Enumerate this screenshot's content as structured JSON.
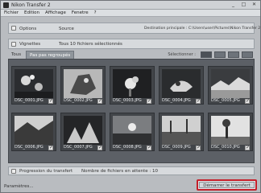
{
  "window": {
    "title": "Nikon Transfer 2"
  },
  "menu": {
    "items": [
      "Fichier",
      "Edition",
      "Affichage",
      "Fenetre",
      "?"
    ]
  },
  "source_row": {
    "label": "Options",
    "value": "Source",
    "destination": "Destination principale : C:\\Users\\user\\Pictures\\Nikon Transfer 2"
  },
  "selection_row": {
    "label": "Vignettes",
    "value": "Tous 10 fichiers sélectionnés"
  },
  "tabs": [
    {
      "label": "Tous"
    },
    {
      "label": "Pas pas regroupés"
    }
  ],
  "view_label": "Sélectionner :",
  "thumbnails": [
    {
      "name": "DSC_0001.JPG"
    },
    {
      "name": "DSC_0002.JPG"
    },
    {
      "name": "DSC_0003.JPG"
    },
    {
      "name": "DSC_0004.JPG"
    },
    {
      "name": "DSC_0005.JPG"
    },
    {
      "name": "DSC_0006.JPG"
    },
    {
      "name": "DSC_0007.JPG"
    },
    {
      "name": "DSC_0008.JPG"
    },
    {
      "name": "DSC_0009.JPG"
    },
    {
      "name": "DSC_0010.JPG"
    }
  ],
  "queue_row": {
    "label": "Progression du transfert",
    "value": "Nombre de fichiers en attente : 10"
  },
  "status": "Paramètres...",
  "start_button": "Démarrer le transfert",
  "colors": {
    "highlight": "#c51f2a"
  }
}
